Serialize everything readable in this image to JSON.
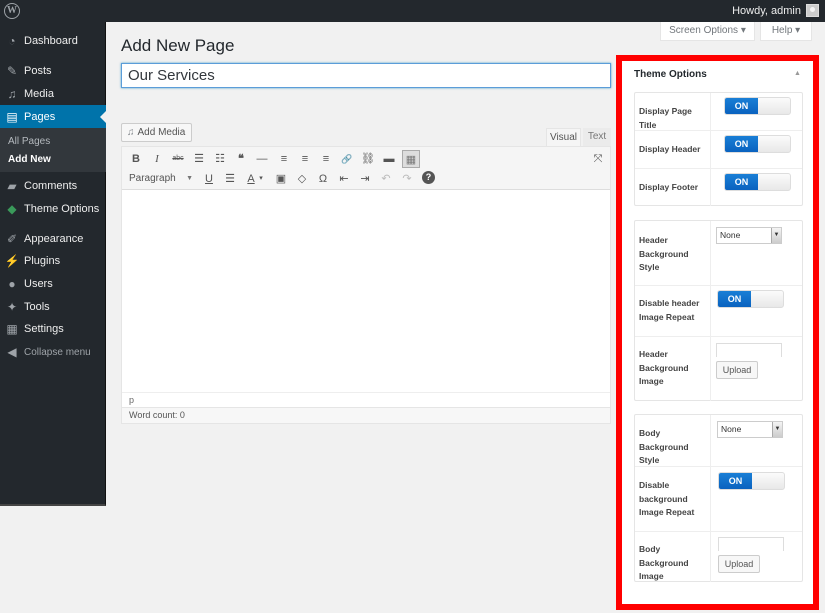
{
  "adminbar": {
    "logo": "W",
    "greeting": "Howdy, admin"
  },
  "sidebar": {
    "items": [
      {
        "label": "Dashboard",
        "icon": "dashboard-icon",
        "glyph": "◔"
      },
      {
        "label": "Posts",
        "icon": "pin-icon",
        "glyph": "✎"
      },
      {
        "label": "Media",
        "icon": "media-icon",
        "glyph": "♫"
      },
      {
        "label": "Pages",
        "icon": "pages-icon",
        "glyph": "▤"
      },
      {
        "label": "Comments",
        "icon": "comment-icon",
        "glyph": "▰"
      },
      {
        "label": "Theme Options",
        "icon": "theme-options-icon",
        "glyph": "◆"
      },
      {
        "label": "Appearance",
        "icon": "paintbrush-icon",
        "glyph": "✐"
      },
      {
        "label": "Plugins",
        "icon": "plugin-icon",
        "glyph": "⚡"
      },
      {
        "label": "Users",
        "icon": "user-icon",
        "glyph": "●"
      },
      {
        "label": "Tools",
        "icon": "wrench-icon",
        "glyph": "✦"
      },
      {
        "label": "Settings",
        "icon": "settings-icon",
        "glyph": "▦"
      }
    ],
    "submenu": [
      {
        "label": "All Pages"
      },
      {
        "label": "Add New"
      }
    ],
    "collapse": {
      "label": "Collapse menu",
      "glyph": "◀"
    }
  },
  "header": {
    "title": "Add New Page",
    "screen_options": "Screen Options ▾",
    "help": "Help ▾"
  },
  "post": {
    "title_value": "Our Services"
  },
  "editor": {
    "add_media": "Add Media",
    "tabs": {
      "visual": "Visual",
      "text": "Text"
    },
    "toolbar_row1": [
      {
        "name": "bold-icon",
        "glyph": "B"
      },
      {
        "name": "italic-icon",
        "glyph": "I"
      },
      {
        "name": "strikethrough-icon",
        "glyph": "abc"
      },
      {
        "name": "bullet-list-icon",
        "glyph": "☰"
      },
      {
        "name": "numbered-list-icon",
        "glyph": "☷"
      },
      {
        "name": "blockquote-icon",
        "glyph": "❝"
      },
      {
        "name": "horizontal-rule-icon",
        "glyph": "—"
      },
      {
        "name": "align-left-icon",
        "glyph": "≡"
      },
      {
        "name": "align-center-icon",
        "glyph": "≡"
      },
      {
        "name": "align-right-icon",
        "glyph": "≡"
      },
      {
        "name": "link-icon",
        "glyph": "🔗"
      },
      {
        "name": "unlink-icon",
        "glyph": "⛓"
      },
      {
        "name": "read-more-icon",
        "glyph": "▬"
      },
      {
        "name": "toolbar-toggle-icon",
        "glyph": "▦"
      }
    ],
    "fullscreen": {
      "name": "fullscreen-icon",
      "glyph": "⤧"
    },
    "format_select": "Paragraph",
    "toolbar_row2": [
      {
        "name": "underline-icon",
        "glyph": "U"
      },
      {
        "name": "justify-icon",
        "glyph": "☰"
      },
      {
        "name": "text-color-icon",
        "glyph": "A"
      },
      {
        "name": "text-color-dropdown-icon",
        "glyph": "▾"
      },
      {
        "name": "paste-text-icon",
        "glyph": "▣"
      },
      {
        "name": "clear-formatting-icon",
        "glyph": "◇"
      },
      {
        "name": "special-character-icon",
        "glyph": "Ω"
      },
      {
        "name": "outdent-icon",
        "glyph": "⇤"
      },
      {
        "name": "indent-icon",
        "glyph": "⇥"
      },
      {
        "name": "undo-icon",
        "glyph": "↶"
      },
      {
        "name": "redo-icon",
        "glyph": "↷"
      },
      {
        "name": "help-icon",
        "glyph": "?"
      }
    ],
    "path": "p",
    "word_count": "Word count: 0"
  },
  "theme_options": {
    "title": "Theme Options",
    "toggle_glyph": "▲",
    "group1": [
      {
        "label": "Display Page Title",
        "state": "ON"
      },
      {
        "label": "Display Header",
        "state": "ON"
      },
      {
        "label": "Display Footer",
        "state": "ON"
      }
    ],
    "group2": {
      "header_bg_style": {
        "label": "Header Background Style",
        "value": "None"
      },
      "disable_header_repeat": {
        "label": "Disable header Image Repeat",
        "state": "ON"
      },
      "header_bg_image": {
        "label": "Header Background Image",
        "upload": "Upload",
        "value": ""
      }
    },
    "group3": {
      "body_bg_style": {
        "label": "Body Background Style",
        "value": "None"
      },
      "disable_bg_repeat": {
        "label": "Disable background Image Repeat",
        "state": "ON"
      },
      "body_bg_image": {
        "label": "Body Background Image",
        "upload": "Upload",
        "value": ""
      }
    },
    "highlight_color": "#ff0000",
    "toggle_color": "#0a6fcc"
  }
}
